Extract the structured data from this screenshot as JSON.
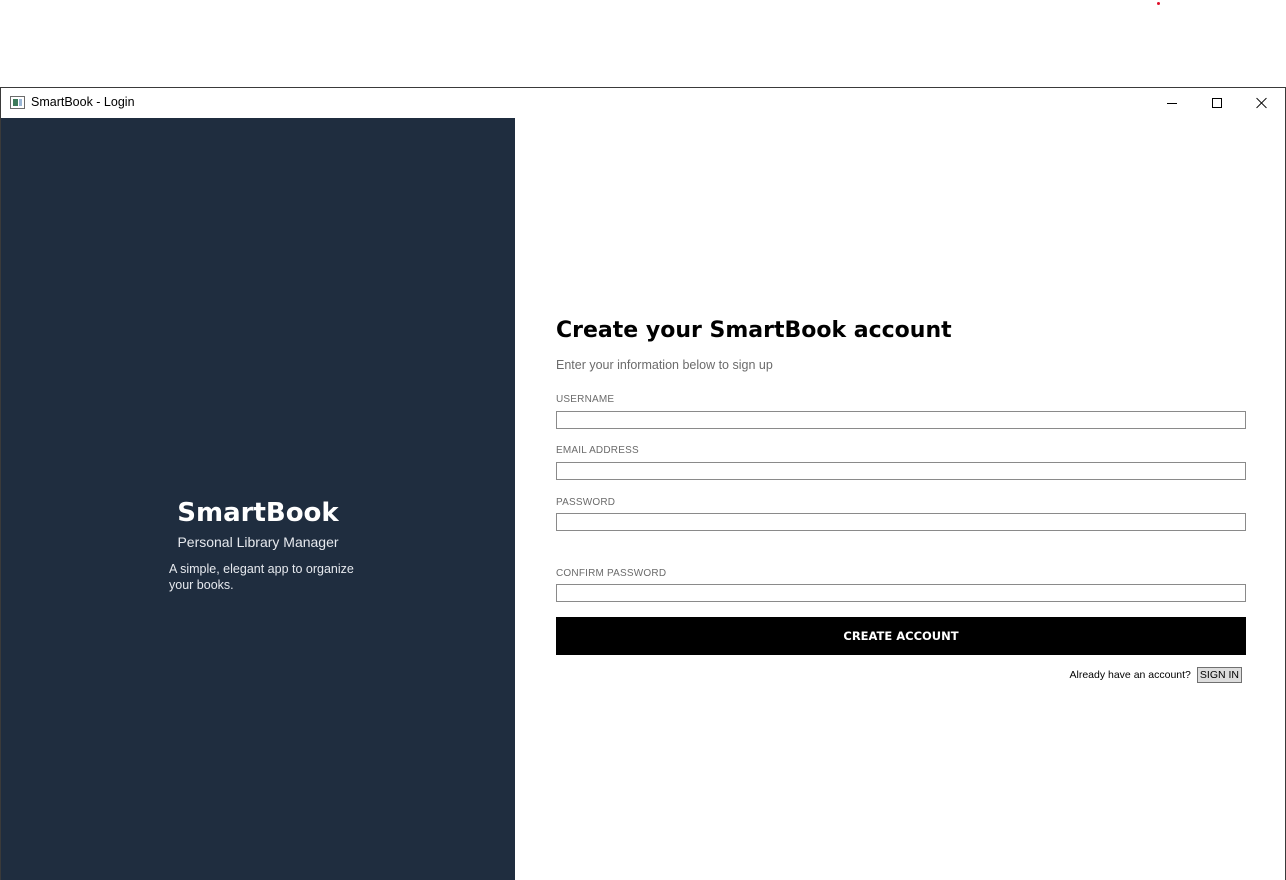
{
  "window": {
    "title": "SmartBook - Login"
  },
  "brand": {
    "name": "SmartBook",
    "tagline": "Personal Library Manager",
    "description": "A simple, elegant app to organize your books."
  },
  "form": {
    "heading": "Create your SmartBook account",
    "subheading": "Enter your information below to sign up",
    "fields": {
      "username": {
        "label": "USERNAME",
        "value": ""
      },
      "email": {
        "label": "EMAIL ADDRESS",
        "value": ""
      },
      "password": {
        "label": "PASSWORD",
        "value": ""
      },
      "confirm_password": {
        "label": "CONFIRM PASSWORD",
        "value": ""
      }
    },
    "submit_label": "CREATE ACCOUNT",
    "signin_prompt": "Already have an account?",
    "signin_label": "SIGN IN"
  },
  "colors": {
    "left_panel_bg": "#1f2d3f",
    "button_bg": "#000000"
  },
  "icons": {
    "app": "app-window-icon",
    "minimize": "minimize-icon",
    "maximize": "maximize-icon",
    "close": "close-icon"
  }
}
